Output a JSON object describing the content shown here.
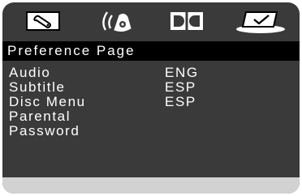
{
  "tabs": [
    {
      "icon": "wrench-icon",
      "selected": false
    },
    {
      "icon": "speaker-audio-icon",
      "selected": false
    },
    {
      "icon": "dolby-icon",
      "selected": false
    },
    {
      "icon": "checkmark-icon",
      "selected": true
    }
  ],
  "page": {
    "title": "Preference Page"
  },
  "items": [
    {
      "label": "Audio",
      "value": "ENG"
    },
    {
      "label": "Subtitle",
      "value": "ESP"
    },
    {
      "label": "Disc Menu",
      "value": "ESP"
    },
    {
      "label": "Parental",
      "value": ""
    },
    {
      "label": "Password",
      "value": ""
    }
  ],
  "colors": {
    "panel": "#3a3a3a",
    "title_bar": "#000000",
    "footer": "#d2d2d2",
    "text": "#ffffff"
  }
}
